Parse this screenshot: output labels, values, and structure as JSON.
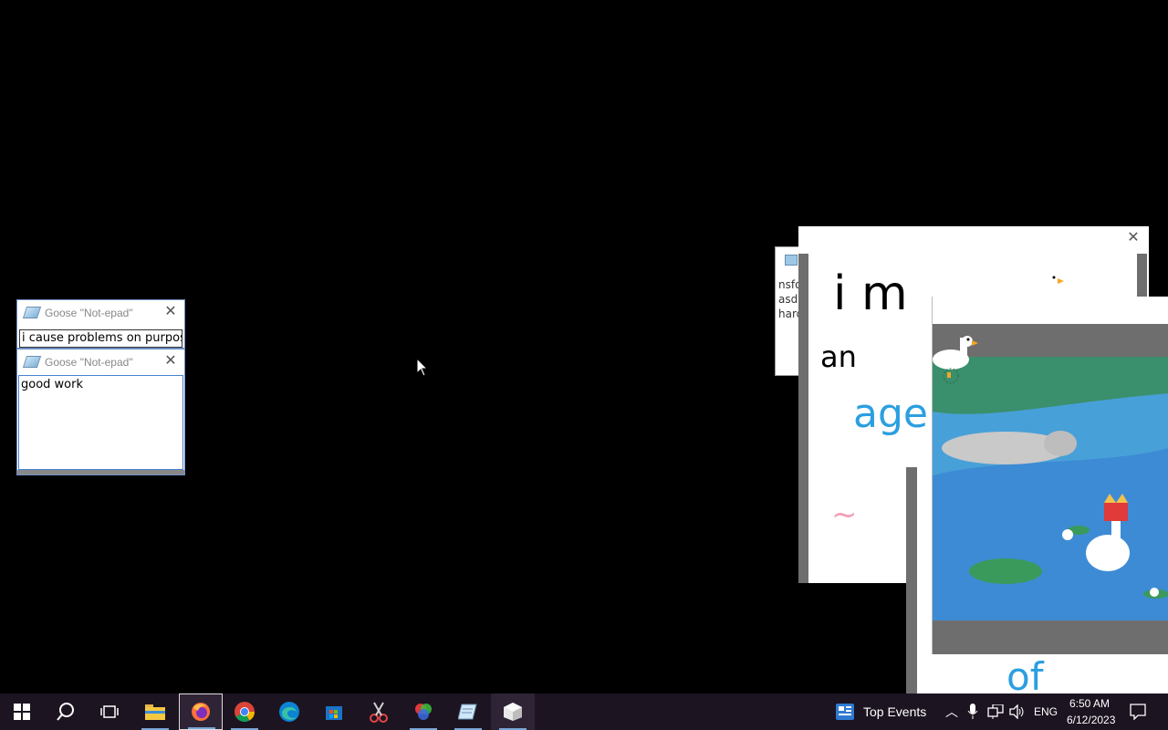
{
  "notepad1": {
    "title": "Goose \"Not-epad\"",
    "text": "i cause problems on purpose"
  },
  "notepad2": {
    "title": "Goose \"Not-epad\"",
    "text": "good work"
  },
  "back_notepad": {
    "lines": [
      "nsfo",
      "asd",
      "hard"
    ]
  },
  "drawing": {
    "line1": "i m",
    "line2": "an",
    "line3": "age",
    "line4": "of"
  },
  "taskbar": {
    "apps": [
      "start-icon",
      "search-icon",
      "task-view-icon",
      "file-explorer-icon",
      "firefox-icon",
      "chrome-icon",
      "edge-icon",
      "store-icon",
      "snipping-tool-icon",
      "color-wheel-icon",
      "notepad-icon",
      "goose-app-icon"
    ],
    "widget_label": "Top Events",
    "language": "ENG",
    "time": "6:50 AM",
    "date": "6/12/2023"
  },
  "colors": {
    "accent": "#7aa6d6",
    "ink_black": "#000000",
    "ink_blue": "#2b9fe0",
    "ink_pink": "#f3a0b8",
    "taskbar": "#1c1421"
  }
}
